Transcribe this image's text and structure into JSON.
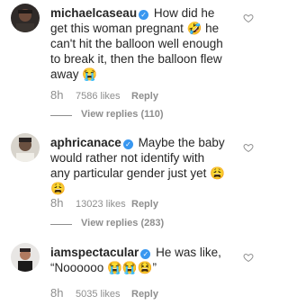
{
  "comments": [
    {
      "username": "michaelcaseau",
      "text": "How did he get this woman pregnant 🤣 he can't hit the balloon well enough to break it, then the balloon flew away 😭",
      "time": "8h",
      "likes": "7586 likes",
      "reply": "Reply",
      "view_replies": "View replies (110)"
    },
    {
      "username": "aphricanace",
      "text": "Maybe the baby would rather not identify with any particular gender just yet 😩😩",
      "time": "8h",
      "likes": "13023 likes",
      "reply": "Reply",
      "view_replies": "View replies (283)"
    },
    {
      "username": "iamspectacular",
      "text": "He was like, “Noooooo 😭😭😫”",
      "time": "8h",
      "likes": "5035 likes",
      "reply": "Reply"
    }
  ],
  "icons": {
    "verified": "verified-badge-icon",
    "like": "heart-outline-icon"
  },
  "colors": {
    "verified": "#3897f0",
    "secondary_text": "#8e8e8e",
    "primary_text": "#262626"
  }
}
